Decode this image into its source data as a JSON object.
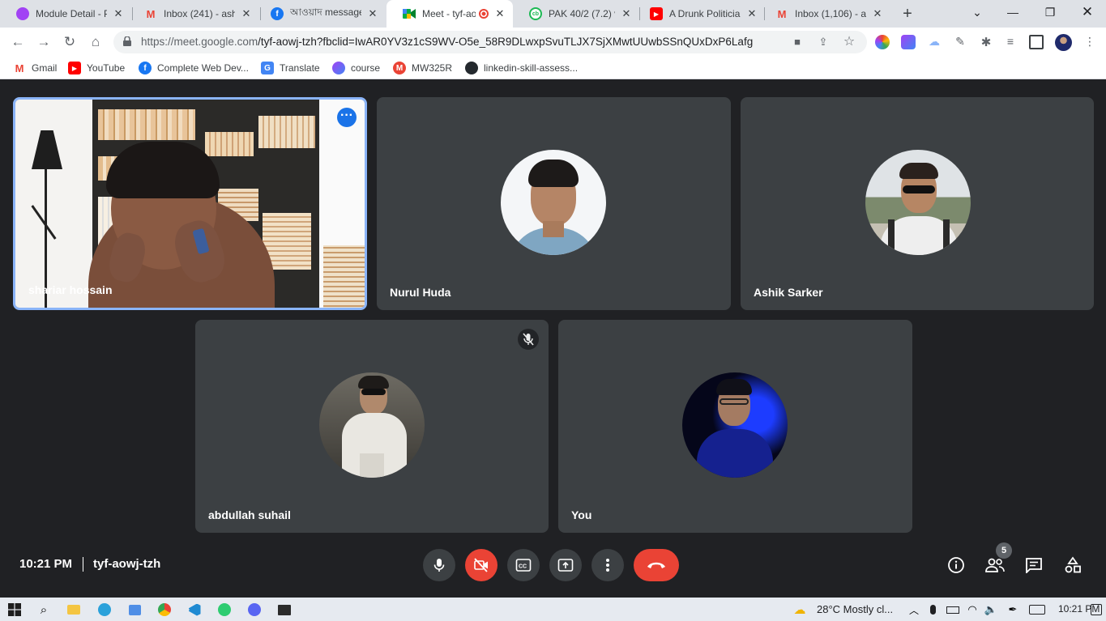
{
  "browser": {
    "tabs": [
      {
        "title": "Module Detail - P",
        "favicon_color": "#a142f4"
      },
      {
        "title": "Inbox (241) - ash",
        "favicon_color": "#ea4335"
      },
      {
        "title": "আওয়াদ message",
        "favicon_color": "#1877f2"
      },
      {
        "title": "Meet - tyf-ao",
        "favicon_color": "#00897b"
      },
      {
        "title": "PAK 40/2 (7.2) vs",
        "favicon_color": "#1db954"
      },
      {
        "title": "A Drunk Politician",
        "favicon_color": "#ff0000"
      },
      {
        "title": "Inbox (1,106) - as",
        "favicon_color": "#ea4335"
      }
    ],
    "url_host": "https://meet.google.com",
    "url_path": "/tyf-aowj-tzh?fbclid=IwAR0YV3z1cS9WV-O5e_58R9DLwxpSvuTLJX7SjXMwtUUwbSSnQUxDxP6Lafg",
    "bookmarks": [
      {
        "label": "Gmail",
        "color": "#ea4335",
        "glyph": "M"
      },
      {
        "label": "YouTube",
        "color": "#ff0000",
        "glyph": "▶"
      },
      {
        "label": "Complete Web Dev...",
        "color": "#1877f2",
        "glyph": "f"
      },
      {
        "label": "Translate",
        "color": "#4285f4",
        "glyph": "G"
      },
      {
        "label": "course",
        "color": "#a142f4",
        "glyph": "●"
      },
      {
        "label": "MW325R",
        "color": "#ea4335",
        "glyph": "M"
      },
      {
        "label": "linkedin-skill-assess...",
        "color": "#24292e",
        "glyph": "●"
      }
    ]
  },
  "meet": {
    "participants": [
      {
        "name": "shariar hossain",
        "video_on": true,
        "speaking": true
      },
      {
        "name": "Nurul Huda",
        "video_on": false
      },
      {
        "name": "Ashik Sarker",
        "video_on": false
      },
      {
        "name": "abdullah suhail",
        "video_on": false,
        "muted": true
      },
      {
        "name": "You",
        "video_on": false
      }
    ],
    "time": "10:21 PM",
    "meeting_code": "tyf-aowj-tzh",
    "participant_count": "5",
    "colors": {
      "end_call": "#ea4335",
      "camera_off": "#ea4335",
      "tile_bg": "#3c4043",
      "active_border": "#8ab4f8"
    }
  },
  "taskbar": {
    "weather": "28°C  Mostly cl...",
    "clock": "10:21 PM"
  }
}
